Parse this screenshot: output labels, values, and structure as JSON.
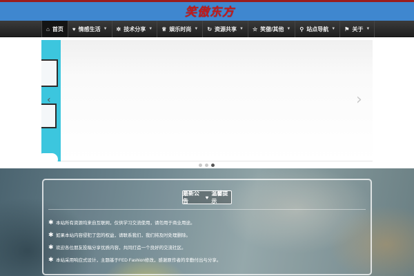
{
  "header": {
    "logo_text": "笑傲东方"
  },
  "nav": {
    "items": [
      {
        "icon": "home-icon",
        "glyph": "⌂",
        "label": "首页",
        "dropdown": false
      },
      {
        "icon": "heart-icon",
        "glyph": "♥",
        "label": "情感生活",
        "dropdown": true
      },
      {
        "icon": "gear-icon",
        "glyph": "✲",
        "label": "技术分享",
        "dropdown": true
      },
      {
        "icon": "trophy-icon",
        "glyph": "♕",
        "label": "娱乐时尚",
        "dropdown": true
      },
      {
        "icon": "refresh-icon",
        "glyph": "↻",
        "label": "资源共享",
        "dropdown": true
      },
      {
        "icon": "star-icon",
        "glyph": "☆",
        "label": "笑傲/其他",
        "dropdown": true
      },
      {
        "icon": "map-marker-icon",
        "glyph": "⚲",
        "label": "站点导航",
        "dropdown": true
      },
      {
        "icon": "flag-icon",
        "glyph": "⚑",
        "label": "关于",
        "dropdown": true
      }
    ]
  },
  "slider": {
    "slide_count": 3,
    "active_index": 2
  },
  "panel": {
    "badge_left": "最新公告",
    "badge_right": "温馨提示",
    "tips": [
      "本站所有资源均来自互联网，仅供学习交流使用，请勿用于商业用途。",
      "如果本站内容侵犯了您的权益，请联系我们，我们将及时处理删除。",
      "欢迎各位朋友投稿分享优质内容，共同打造一个良好的交流社区。",
      "本站采用响应式设计，主题基于FED Fashion修改，感谢原作者的辛勤付出与分享。"
    ]
  },
  "colors": {
    "header_blue": "#3f87cf",
    "top_line": "#9b1c1c",
    "logo_red": "#c21a1a",
    "nav_dark": "#2a2a2a"
  }
}
